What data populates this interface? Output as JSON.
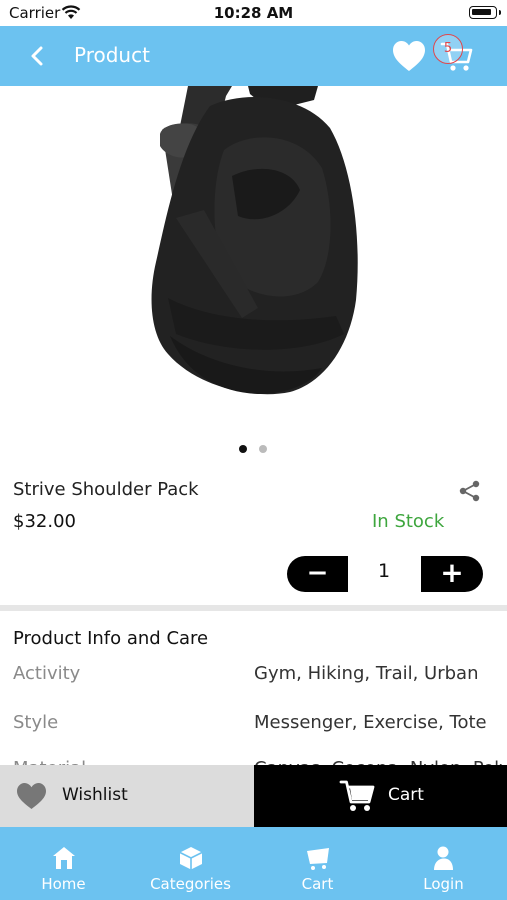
{
  "status_bar": {
    "carrier": "Carrier",
    "time": "10:28 AM"
  },
  "nav": {
    "title": "Product",
    "cart_count": "5"
  },
  "product": {
    "name": "Strive Shoulder Pack",
    "price": "$32.00",
    "stock": "In Stock",
    "quantity": "1",
    "image_slide": 1,
    "image_slide_count": 2
  },
  "info": {
    "title": "Product Info and Care",
    "rows": [
      {
        "key": "Activity",
        "value": "Gym, Hiking, Trail, Urban"
      },
      {
        "key": "Style",
        "value": "Messenger, Exercise, Tote"
      },
      {
        "key": "Material",
        "value": "Canvas, Cocona, Nylon, Polyester"
      }
    ]
  },
  "actions": {
    "wishlist": "Wishlist",
    "cart": "Cart"
  },
  "tabs": [
    {
      "label": "Home",
      "icon": "home-icon"
    },
    {
      "label": "Categories",
      "icon": "categories-icon"
    },
    {
      "label": "Cart",
      "icon": "cart-icon"
    },
    {
      "label": "Login",
      "icon": "user-icon"
    }
  ],
  "colors": {
    "primary": "#6cc2f0",
    "in_stock": "#3ea63e",
    "badge": "#e0474c"
  },
  "icons": {
    "back": "chevron-left-icon",
    "wishlist": "heart-icon",
    "share": "share-icon"
  }
}
